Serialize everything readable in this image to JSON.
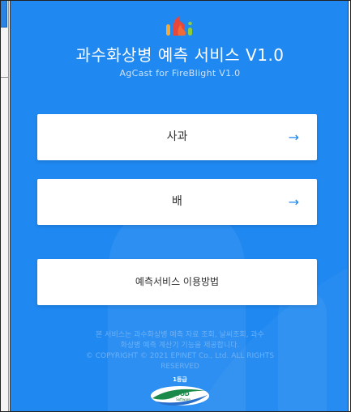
{
  "app": {
    "title": "과수화상병 예측 서비스 V1.0",
    "subtitle": "AgCast for FireBlight V1.0",
    "background_color": "#1f88f1"
  },
  "menu": [
    {
      "label": "사과",
      "arrow": "→"
    },
    {
      "label": "배",
      "arrow": "→"
    }
  ],
  "guide_button": {
    "label": "예측서비스 이용방법"
  },
  "footer": {
    "line1": "본 서비스는 과수화상병 예측 자료 조회, 날씨조회, 과수",
    "line2": "화상병 예측 계산기 기능을 제공합니다.",
    "line3": "© COPYRIGHT © 2021 EPINET Co., Ltd. ALL RIGHTS",
    "line4": "RESERVED"
  },
  "certification": {
    "grade": "1등급",
    "badge_text_top": "GOOD",
    "badge_text_bottom": "Software"
  },
  "icons": {
    "logo": "flame-logo-icon",
    "arrow": "arrow-right-icon"
  }
}
